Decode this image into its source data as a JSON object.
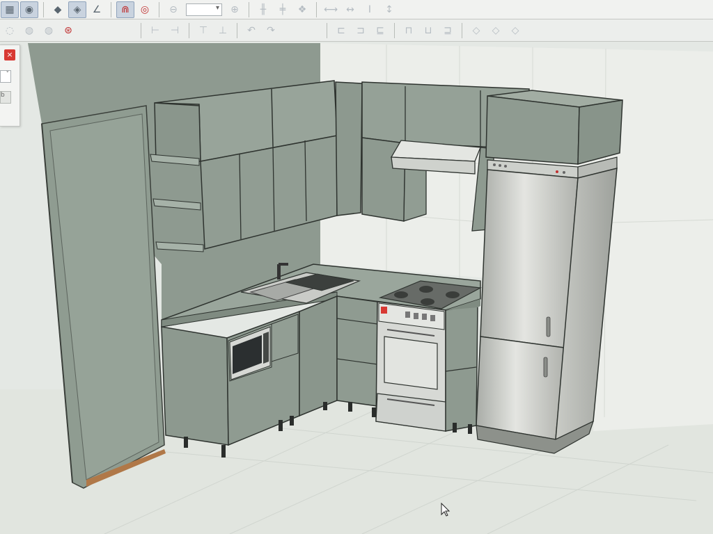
{
  "toolbar1": {
    "buttons": [
      {
        "name": "grid-icon",
        "glyph": "▦",
        "active": true
      },
      {
        "name": "eye-icon",
        "glyph": "◉",
        "active": true
      },
      {
        "name": "diamond-icon",
        "glyph": "◆",
        "active": false
      },
      {
        "name": "diamond-select-icon",
        "glyph": "◈",
        "active": true
      },
      {
        "name": "angle-icon",
        "glyph": "∠",
        "active": false
      },
      {
        "name": "magnet-icon",
        "glyph": "⋒",
        "active": true
      },
      {
        "name": "target-icon",
        "glyph": "◎",
        "active": false
      },
      {
        "name": "zoom-out-icon",
        "glyph": "⊖",
        "active": false
      },
      {
        "name": "zoom-in-icon",
        "glyph": "⊕",
        "active": false
      }
    ],
    "zoom_value": ""
  },
  "toolbar2": {
    "buttons": [
      {
        "name": "eye-icon"
      },
      {
        "name": "eye-icon"
      },
      {
        "name": "eye-icon"
      },
      {
        "name": "lifebuoy-icon"
      }
    ]
  },
  "left_panel": {
    "close_label": "×",
    "combo_arrow": "˅",
    "button_label": "b"
  },
  "colors": {
    "cabinet": "#8e9a8f",
    "wall": "#8e9a90",
    "floor": "#e2e6e1",
    "steel": "#c4c6c2",
    "accent_red": "#d83a34"
  }
}
